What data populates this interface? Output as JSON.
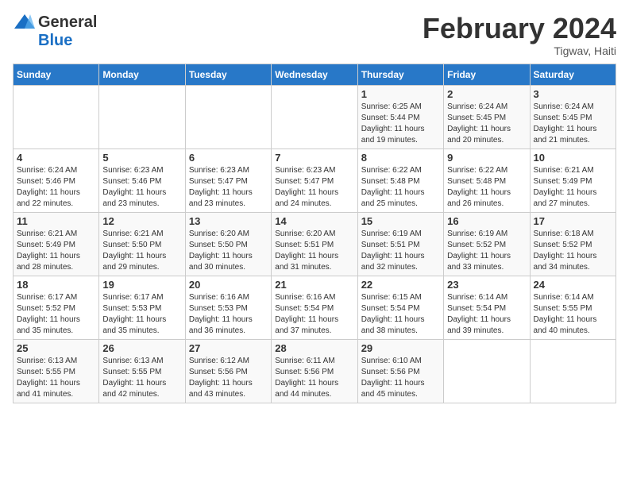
{
  "header": {
    "logo_general": "General",
    "logo_blue": "Blue",
    "month_title": "February 2024",
    "location": "Tigwav, Haiti"
  },
  "days_of_week": [
    "Sunday",
    "Monday",
    "Tuesday",
    "Wednesday",
    "Thursday",
    "Friday",
    "Saturday"
  ],
  "weeks": [
    [
      {
        "day": "",
        "info": ""
      },
      {
        "day": "",
        "info": ""
      },
      {
        "day": "",
        "info": ""
      },
      {
        "day": "",
        "info": ""
      },
      {
        "day": "1",
        "info": "Sunrise: 6:25 AM\nSunset: 5:44 PM\nDaylight: 11 hours\nand 19 minutes."
      },
      {
        "day": "2",
        "info": "Sunrise: 6:24 AM\nSunset: 5:45 PM\nDaylight: 11 hours\nand 20 minutes."
      },
      {
        "day": "3",
        "info": "Sunrise: 6:24 AM\nSunset: 5:45 PM\nDaylight: 11 hours\nand 21 minutes."
      }
    ],
    [
      {
        "day": "4",
        "info": "Sunrise: 6:24 AM\nSunset: 5:46 PM\nDaylight: 11 hours\nand 22 minutes."
      },
      {
        "day": "5",
        "info": "Sunrise: 6:23 AM\nSunset: 5:46 PM\nDaylight: 11 hours\nand 23 minutes."
      },
      {
        "day": "6",
        "info": "Sunrise: 6:23 AM\nSunset: 5:47 PM\nDaylight: 11 hours\nand 23 minutes."
      },
      {
        "day": "7",
        "info": "Sunrise: 6:23 AM\nSunset: 5:47 PM\nDaylight: 11 hours\nand 24 minutes."
      },
      {
        "day": "8",
        "info": "Sunrise: 6:22 AM\nSunset: 5:48 PM\nDaylight: 11 hours\nand 25 minutes."
      },
      {
        "day": "9",
        "info": "Sunrise: 6:22 AM\nSunset: 5:48 PM\nDaylight: 11 hours\nand 26 minutes."
      },
      {
        "day": "10",
        "info": "Sunrise: 6:21 AM\nSunset: 5:49 PM\nDaylight: 11 hours\nand 27 minutes."
      }
    ],
    [
      {
        "day": "11",
        "info": "Sunrise: 6:21 AM\nSunset: 5:49 PM\nDaylight: 11 hours\nand 28 minutes."
      },
      {
        "day": "12",
        "info": "Sunrise: 6:21 AM\nSunset: 5:50 PM\nDaylight: 11 hours\nand 29 minutes."
      },
      {
        "day": "13",
        "info": "Sunrise: 6:20 AM\nSunset: 5:50 PM\nDaylight: 11 hours\nand 30 minutes."
      },
      {
        "day": "14",
        "info": "Sunrise: 6:20 AM\nSunset: 5:51 PM\nDaylight: 11 hours\nand 31 minutes."
      },
      {
        "day": "15",
        "info": "Sunrise: 6:19 AM\nSunset: 5:51 PM\nDaylight: 11 hours\nand 32 minutes."
      },
      {
        "day": "16",
        "info": "Sunrise: 6:19 AM\nSunset: 5:52 PM\nDaylight: 11 hours\nand 33 minutes."
      },
      {
        "day": "17",
        "info": "Sunrise: 6:18 AM\nSunset: 5:52 PM\nDaylight: 11 hours\nand 34 minutes."
      }
    ],
    [
      {
        "day": "18",
        "info": "Sunrise: 6:17 AM\nSunset: 5:52 PM\nDaylight: 11 hours\nand 35 minutes."
      },
      {
        "day": "19",
        "info": "Sunrise: 6:17 AM\nSunset: 5:53 PM\nDaylight: 11 hours\nand 35 minutes."
      },
      {
        "day": "20",
        "info": "Sunrise: 6:16 AM\nSunset: 5:53 PM\nDaylight: 11 hours\nand 36 minutes."
      },
      {
        "day": "21",
        "info": "Sunrise: 6:16 AM\nSunset: 5:54 PM\nDaylight: 11 hours\nand 37 minutes."
      },
      {
        "day": "22",
        "info": "Sunrise: 6:15 AM\nSunset: 5:54 PM\nDaylight: 11 hours\nand 38 minutes."
      },
      {
        "day": "23",
        "info": "Sunrise: 6:14 AM\nSunset: 5:54 PM\nDaylight: 11 hours\nand 39 minutes."
      },
      {
        "day": "24",
        "info": "Sunrise: 6:14 AM\nSunset: 5:55 PM\nDaylight: 11 hours\nand 40 minutes."
      }
    ],
    [
      {
        "day": "25",
        "info": "Sunrise: 6:13 AM\nSunset: 5:55 PM\nDaylight: 11 hours\nand 41 minutes."
      },
      {
        "day": "26",
        "info": "Sunrise: 6:13 AM\nSunset: 5:55 PM\nDaylight: 11 hours\nand 42 minutes."
      },
      {
        "day": "27",
        "info": "Sunrise: 6:12 AM\nSunset: 5:56 PM\nDaylight: 11 hours\nand 43 minutes."
      },
      {
        "day": "28",
        "info": "Sunrise: 6:11 AM\nSunset: 5:56 PM\nDaylight: 11 hours\nand 44 minutes."
      },
      {
        "day": "29",
        "info": "Sunrise: 6:10 AM\nSunset: 5:56 PM\nDaylight: 11 hours\nand 45 minutes."
      },
      {
        "day": "",
        "info": ""
      },
      {
        "day": "",
        "info": ""
      }
    ]
  ]
}
